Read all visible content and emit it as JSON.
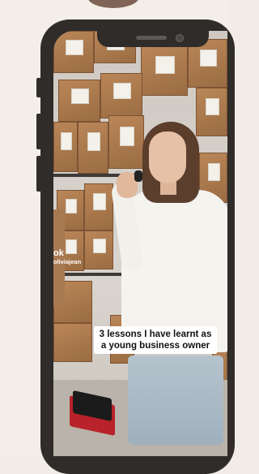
{
  "video": {
    "caption": "3 lessons I have learnt as a young business owner",
    "watermark_brand": "ok",
    "watermark_handle": "oliviajean"
  },
  "colors": {
    "phone_frame": "#2f2c2a",
    "page_background": "#f3efe8",
    "caption_background": "#ffffff",
    "caption_text": "#111111"
  }
}
